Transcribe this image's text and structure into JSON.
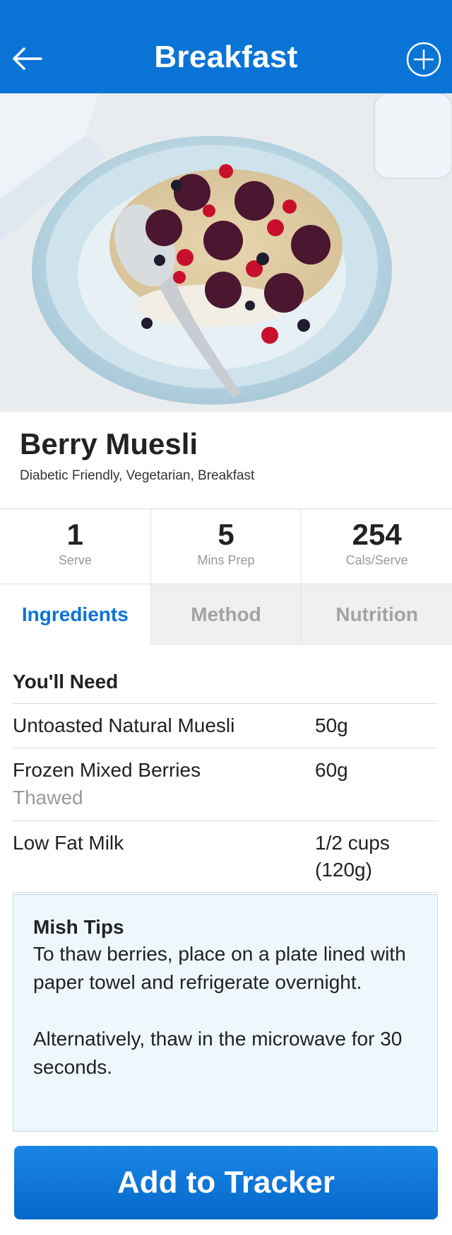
{
  "header": {
    "title": "Breakfast",
    "back_icon": "arrow-left-icon",
    "add_icon": "plus-circle-icon",
    "color": "#0a74d6"
  },
  "hero": {
    "image": "berry-muesli-bowl-photo"
  },
  "recipe": {
    "title": "Berry Muesli",
    "tags": "Diabetic Friendly, Vegetarian, Breakfast"
  },
  "stats": [
    {
      "value": "1",
      "label": "Serve"
    },
    {
      "value": "5",
      "label": "Mins Prep"
    },
    {
      "value": "254",
      "label": "Cals/Serve"
    }
  ],
  "tabs": [
    {
      "label": "Ingredients",
      "active": true
    },
    {
      "label": "Method",
      "active": false
    },
    {
      "label": "Nutrition",
      "active": false
    }
  ],
  "ingredients": {
    "section_title": "You'll Need",
    "items": [
      {
        "name": "Untoasted Natural Muesli",
        "note": "",
        "qty": "50g"
      },
      {
        "name": "Frozen Mixed Berries",
        "note": "Thawed",
        "qty": "60g"
      },
      {
        "name": "Low Fat Milk",
        "note": "",
        "qty": "1/2 cups (120g)"
      }
    ]
  },
  "tips": {
    "title": "Mish Tips",
    "body": "To thaw berries, place on a plate lined with paper towel and refrigerate overnight.\n\nAlternatively, thaw in the microwave for 30 seconds."
  },
  "cta": {
    "label": "Add to Tracker"
  }
}
